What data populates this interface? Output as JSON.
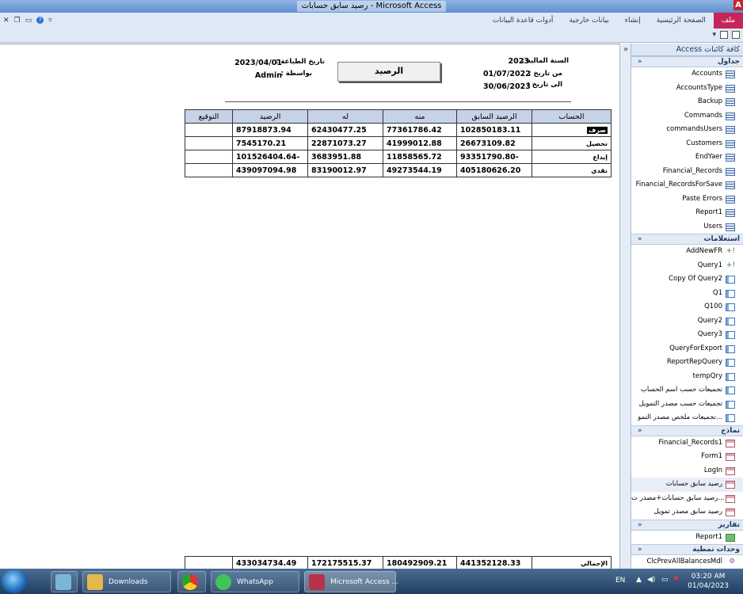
{
  "window": {
    "title": "رصيد سابق حسابات - Microsoft Access",
    "app_badge": "A"
  },
  "ribbon": {
    "tabs": [
      "ملف",
      "الصفحة الرئيسية",
      "إنشاء",
      "بيانات خارجية",
      "أدوات قاعدة البيانات"
    ]
  },
  "report": {
    "title": "الرصيد",
    "fiscal_year_label": "السنة المالية :",
    "fiscal_year": "2023",
    "from_date_label": "من تاريخ :",
    "from_date": "01/07/2022",
    "to_date_label": "الى تاريخ :",
    "to_date": "30/06/2023",
    "print_date_label": "تاريخ الطباعة :",
    "print_date": "2023/04/01",
    "by_label": "بواسطة :",
    "by_user": "Admin",
    "columns": [
      "الحساب",
      "الرصيد السابق",
      "منه",
      "له",
      "الرصيد",
      "التوقيع"
    ],
    "rows": [
      {
        "account": "صرف",
        "prev": "102850183.11",
        "debit": "77361786.42",
        "credit": "62430477.25",
        "balance": "87918873.94",
        "sign": ""
      },
      {
        "account": "تحصيل",
        "prev": "26673109.82",
        "debit": "41999012.88",
        "credit": "22871073.27",
        "balance": "7545170.21",
        "sign": ""
      },
      {
        "account": "إيداع",
        "prev": "-93351790.80",
        "debit": "11858565.72",
        "credit": "3683951.88",
        "balance": "-101526404.64",
        "sign": ""
      },
      {
        "account": "نقدي",
        "prev": "405180626.20",
        "debit": "49273544.19",
        "credit": "83190012.97",
        "balance": "439097094.98",
        "sign": ""
      }
    ],
    "total": {
      "label": "الإجمالي",
      "prev": "441352128.33",
      "debit": "180492909.21",
      "credit": "172175515.37",
      "balance": "433034734.49"
    }
  },
  "nav": {
    "header": "كافة كائنات Access",
    "groups": [
      {
        "name": "جداول",
        "type": "table",
        "items": [
          "Accounts",
          "AccountsType",
          "Backup",
          "Commands",
          "commandsUsers",
          "Customers",
          "EndYaer",
          "Financial_Records",
          "Financial_RecordsForSave",
          "Paste Errors",
          "Report1",
          "Users"
        ]
      },
      {
        "name": "استعلامات",
        "type": "query",
        "items": [
          "AddNewFR",
          "Query1",
          "Copy Of Query2",
          "Q1",
          "Q100",
          "Query2",
          "Query3",
          "QueryForExport",
          "ReportRepQuery",
          "tempQry",
          "تجميعات حسب اسم الحساب",
          "تجميعات حسب مصدر التمويل",
          "تجميعات ملخص مصدر التمو..."
        ]
      },
      {
        "name": "نماذج",
        "type": "form",
        "items": [
          "Financial_Records1",
          "Form1",
          "LogIn",
          "رصيد سابق حسابات",
          "رصيد سابق حسابات+مصدر ت...",
          "رصيد سابق مصدر تمويل"
        ]
      },
      {
        "name": "تقارير",
        "type": "report",
        "items": [
          "Report1"
        ]
      },
      {
        "name": "وحدات نمطية",
        "type": "module",
        "items": [
          "ClcPrevAllBalancesMdl"
        ]
      }
    ]
  },
  "taskbar": {
    "apps": [
      "Downloads",
      "WhatsApp",
      "Microsoft Access ..."
    ],
    "lang": "EN",
    "time": "03:20 AM",
    "date": "01/04/2023"
  }
}
